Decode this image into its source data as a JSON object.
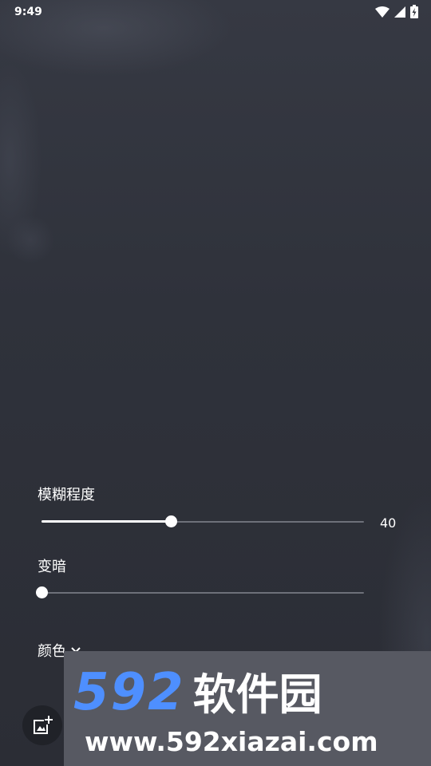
{
  "status_bar": {
    "time": "9:49",
    "icons": [
      "wifi-icon",
      "signal-icon",
      "battery-charging-icon"
    ]
  },
  "blur": {
    "label": "模糊程度",
    "value": 40,
    "value_text": "40",
    "fraction": 0.4
  },
  "darken": {
    "label": "变暗",
    "fraction": 0.0
  },
  "color": {
    "label": "颜色",
    "icon": "chevron-down-icon"
  },
  "fab": {
    "icon": "add-photo-icon"
  },
  "watermark": {
    "brand": "592",
    "brand_cn": "软件园",
    "url": "www.592xiazai.com"
  },
  "colors": {
    "background": "#2e3038",
    "accent": "#ffffff",
    "track": "#6d7079",
    "watermark_blue": "#4e8fff"
  }
}
